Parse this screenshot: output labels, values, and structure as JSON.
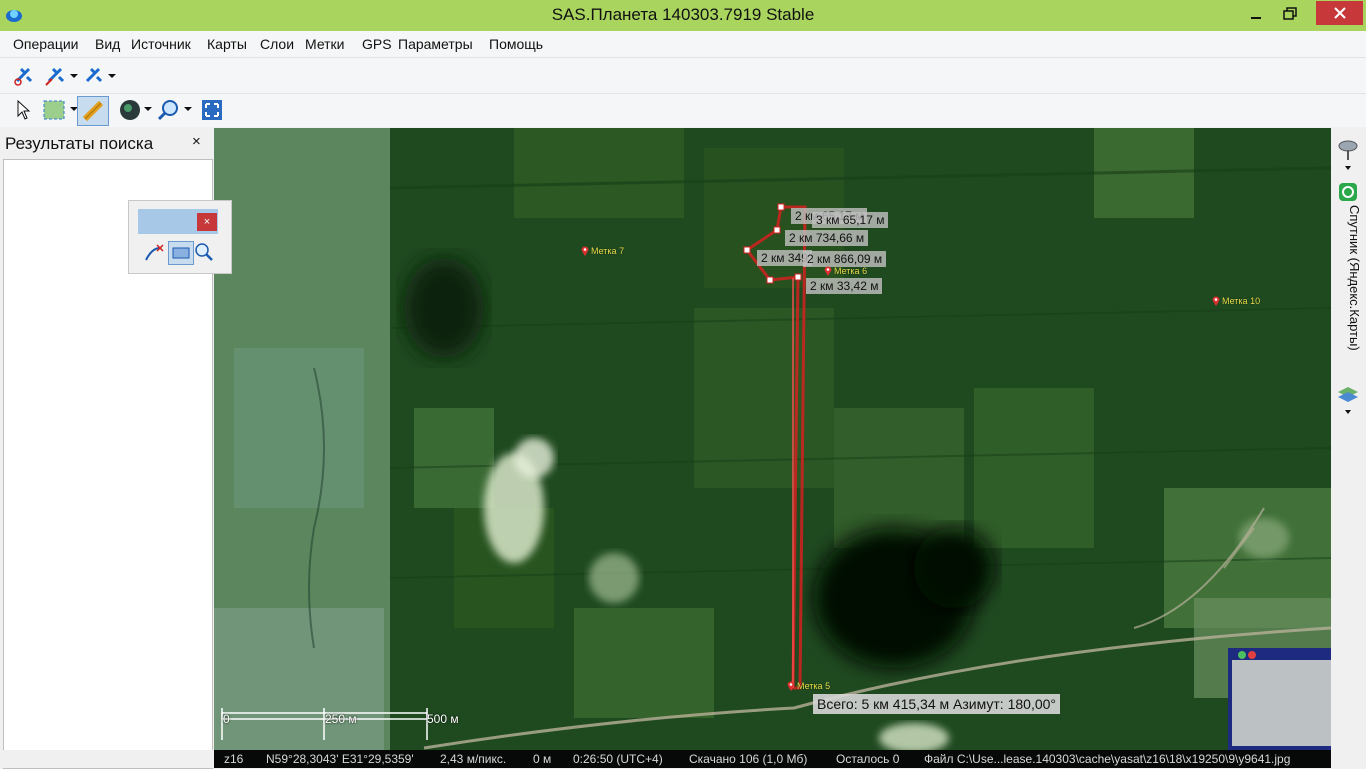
{
  "window": {
    "title": "SAS.Планета 140303.7919 Stable"
  },
  "menu": [
    "Операции",
    "Вид",
    "Источник",
    "Карты",
    "Слои",
    "Метки",
    "GPS",
    "Параметры",
    "Помощь"
  ],
  "left_panel": {
    "title": "Результаты поиска",
    "close": "×"
  },
  "float_toolbar": {
    "close": "×"
  },
  "right_bar": {
    "map_source": "Спутник (Яндекс.Карты)"
  },
  "map": {
    "segments": [
      "2 км 65,17 м",
      "3 км 65,17 м",
      "2 км 734,66 м",
      "2 км 349",
      "2 км 866,09 м",
      "2 км 33,42 м"
    ],
    "total": "Всего: 5 км 415,34 м Азимут: 180,00°",
    "scale": [
      "0",
      "250 м",
      "500 м"
    ],
    "placemarks": [
      "Метка 7",
      "Метка 6",
      "Метка 10",
      "Метка 5"
    ]
  },
  "status": {
    "zoom": "z16",
    "coords": "N59°28,3043' E31°29,5359'",
    "resolution": "2,43 м/пикс.",
    "altitude": "0 м",
    "time": "0:26:50 (UTC+4)",
    "downloaded": "Скачано 106 (1,0 Мб)",
    "remaining": "Осталось 0",
    "file": "Файл C:\\Use...lease.140303\\cache\\yasat\\z16\\18\\x19250\\9\\y9641.jpg"
  },
  "colors": {
    "titlebar": "#a9d55f",
    "route": "#d42020",
    "close": "#c7383a"
  }
}
